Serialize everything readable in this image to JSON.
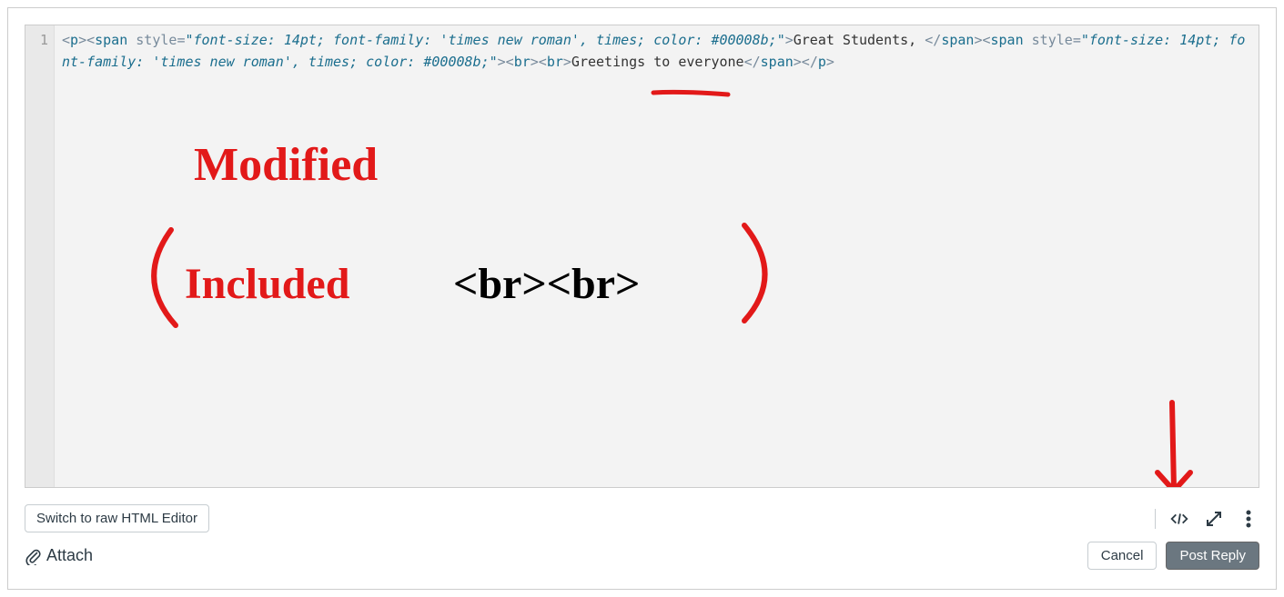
{
  "editor": {
    "line_number": "1",
    "tokens": {
      "bracket_open": "<",
      "bracket_close": ">",
      "close_slash": "</",
      "p": "p",
      "span": "span",
      "br": "br",
      "style_attr": "style",
      "equals": "=",
      "quote": "\"",
      "style_val": "font-size: 14pt; font-family: 'times new roman', times; color: #00008b;",
      "text1": "Great Students, ",
      "text2": "Greetings to everyone"
    }
  },
  "annotations": {
    "modified": "Modified",
    "included": "Included",
    "brbr": "<br><br>"
  },
  "buttons": {
    "switch_editor": "Switch to raw HTML Editor",
    "cancel": "Cancel",
    "post_reply": "Post Reply",
    "attach": "Attach"
  }
}
